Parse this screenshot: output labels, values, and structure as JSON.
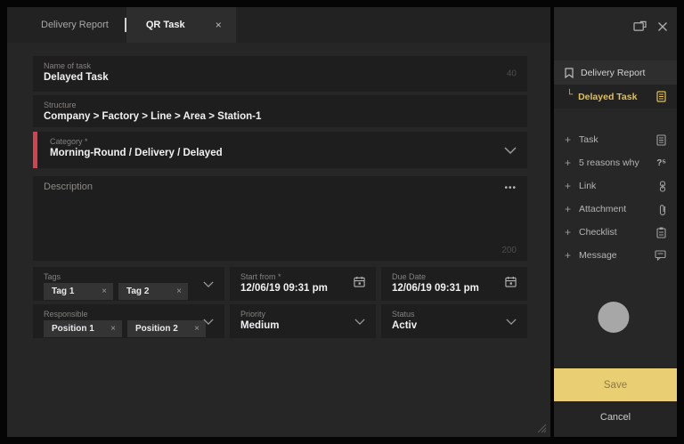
{
  "glyphs": {
    "close": "×",
    "plus": "+",
    "ellipsis": "•••",
    "five_whys": "?⁵",
    "branch": "└"
  },
  "tabs": [
    {
      "label": "Delivery Report",
      "active": false
    },
    {
      "label": "QR Task",
      "active": true
    }
  ],
  "form": {
    "name_of_task": {
      "label": "Name of task",
      "value": "Delayed Task",
      "counter": "40"
    },
    "structure": {
      "label": "Structure",
      "value": "Company > Factory > Line > Area > Station-1"
    },
    "category": {
      "label": "Category *",
      "value": "Morning-Round / Delivery / Delayed"
    },
    "description": {
      "placeholder": "Description",
      "counter": "200"
    },
    "tags": {
      "label": "Tags",
      "chips": [
        "Tag 1",
        "Tag 2"
      ]
    },
    "start_from": {
      "label": "Start from *",
      "value": "12/06/19 09:31 pm"
    },
    "due_date": {
      "label": "Due Date",
      "value": "12/06/19 09:31 pm"
    },
    "responsible": {
      "label": "Responsible",
      "chips": [
        "Position 1",
        "Position 2"
      ]
    },
    "priority": {
      "label": "Priority",
      "value": "Medium"
    },
    "status": {
      "label": "Status",
      "value": "Activ"
    }
  },
  "sidebar": {
    "report_label": "Delivery Report",
    "current_task_label": "Delayed Task",
    "add_items": [
      {
        "label": "Task",
        "icon": "task-icon"
      },
      {
        "label": "5 reasons why",
        "icon": "five-whys-icon"
      },
      {
        "label": "Link",
        "icon": "link-icon"
      },
      {
        "label": "Attachment",
        "icon": "attachment-icon"
      },
      {
        "label": "Checklist",
        "icon": "checklist-icon"
      },
      {
        "label": "Message",
        "icon": "message-icon"
      }
    ],
    "save_label": "Save",
    "cancel_label": "Cancel"
  },
  "colors": {
    "accent_yellow": "#e9ce73",
    "highlight_text": "#e3c14b",
    "required_red": "#d7404d"
  }
}
